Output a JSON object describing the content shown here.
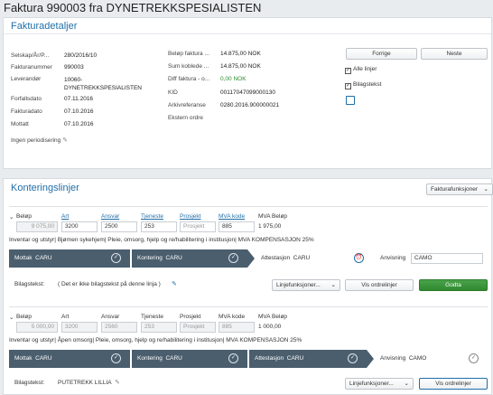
{
  "page": {
    "title": "Faktura 990003 fra DYNETREKKSPESIALISTEN"
  },
  "details": {
    "heading": "Fakturadetaljer",
    "left": [
      {
        "label": "Selskap/År/P...",
        "value": "280/2016/10"
      },
      {
        "label": "Fakturanummer",
        "value": "990003"
      },
      {
        "label": "Leverandør",
        "value": "10060-\nDYNETREKKSPESIALISTEN"
      },
      {
        "label": "Forfallsdato",
        "value": "07.11.2016"
      },
      {
        "label": "Fakturadato",
        "value": "07.10.2016"
      },
      {
        "label": "Mottatt",
        "value": "07.10.2016"
      }
    ],
    "periodisering": "Ingen periodisering",
    "right": [
      {
        "label": "Beløp faktura ...",
        "value": "14.875,00 NOK"
      },
      {
        "label": "Sum koblede ...",
        "value": "14.875,00 NOK"
      },
      {
        "label": "Diff faktura - o...",
        "value": "0,00 NOK"
      },
      {
        "label": "KID",
        "value": "00117047099000130"
      },
      {
        "label": "Arkivreferanse",
        "value": "0280.2016.900000021"
      },
      {
        "label": "Ekstern ordre",
        "value": ""
      }
    ],
    "prev_label": "Forrige",
    "next_label": "Neste",
    "alle_linjer": "Alle linjer",
    "bilagstekst": "Bilagstekst"
  },
  "lines": {
    "heading": "Konteringslinjer",
    "functions_label": "Fakturafunksjoner",
    "headers": {
      "belop": "Beløp",
      "art": "Art",
      "ansvar": "Ansvar",
      "tjeneste": "Tjeneste",
      "prosjekt": "Prosjekt",
      "mva_kode": "MVA kode",
      "mva_belop": "MVA Beløp"
    },
    "items": [
      {
        "belop": "9 075,00",
        "art": "3200",
        "ansvar": "2500",
        "tjeneste": "253",
        "prosjekt": "Prosjekt",
        "mva_kode": "885",
        "mva_belop": "1 975,00",
        "description": "Inventar og utstyr| Bjørnen sykehjem| Pleie, omsorg, hjelp og re/habilitering i institusjon| MVA KOMPENSASJON 25%",
        "steps": [
          {
            "label": "Mottak",
            "value": "CARU"
          },
          {
            "label": "Kontering",
            "value": "CARU"
          },
          {
            "label": "Attestasjon",
            "value": "CARU"
          },
          {
            "label": "Anvisning",
            "value": "CAMO"
          }
        ],
        "bilagstekst_label": "Bilagstekst:",
        "bilagstekst_value": "( Det er ikke bilagstekst på denne linja )",
        "linjefunksjoner": "Linjefunksjoner...",
        "vis_ordrelinjer": "Vis ordrelinjer",
        "godta": "Godta"
      },
      {
        "belop": "5 000,00",
        "art": "3200",
        "ansvar": "2560",
        "tjeneste": "253",
        "prosjekt": "Prosjekt",
        "mva_kode": "885",
        "mva_belop": "1 000,00",
        "description": "Inventar og utstyr| Åpen omsorg| Pleie, omsorg, hjelp og re/habilitering i institusjon| MVA KOMPENSASJON 25%",
        "steps": [
          {
            "label": "Mottak",
            "value": "CARU"
          },
          {
            "label": "Kontering",
            "value": "CARU"
          },
          {
            "label": "Attestasjon",
            "value": "CARU"
          },
          {
            "label": "Anvisning",
            "value": "CAMO"
          }
        ],
        "bilagstekst_label": "Bilagstekst:",
        "bilagstekst_value": "PUTETREKK LILLIA",
        "linjefunksjoner": "Linjefunksjoner...",
        "vis_ordrelinjer": "Vis ordrelinjer"
      }
    ]
  },
  "colors": {
    "accent": "#1f6ea8",
    "step_dark": "#4a5e6e",
    "ok_green": "#2e8b2e",
    "godta_green": "#3a963a"
  }
}
